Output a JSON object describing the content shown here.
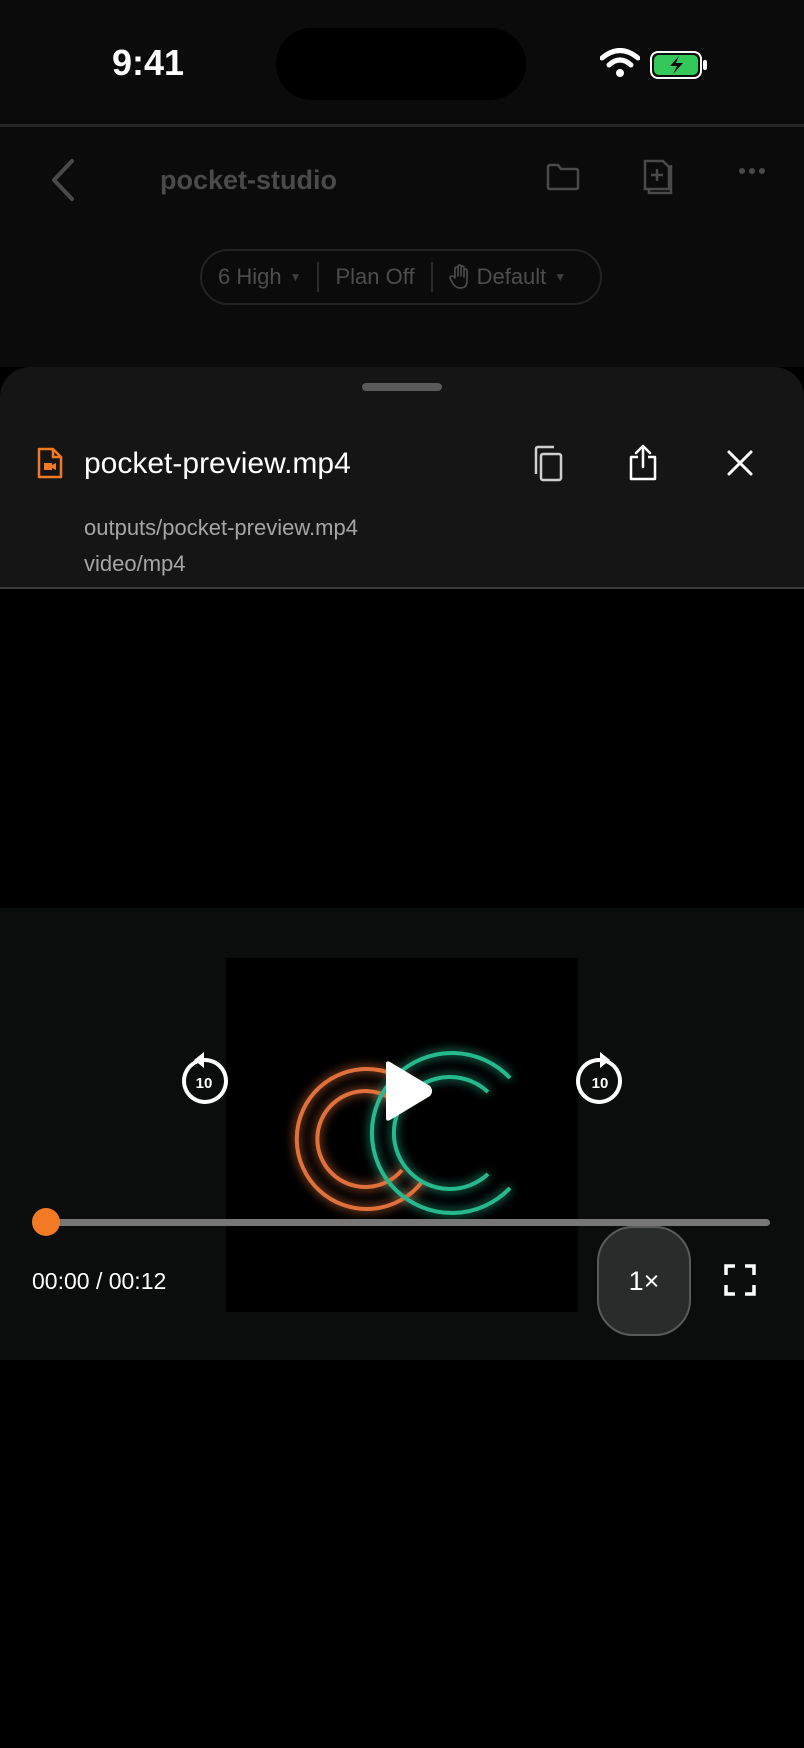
{
  "status_bar": {
    "time": "9:41"
  },
  "header": {
    "title": "pocket-studio",
    "controls": {
      "model": "6 High",
      "plan": "Plan Off",
      "approval": "Default"
    }
  },
  "sheet": {
    "file_name": "pocket-preview.mp4",
    "file_path": "outputs/pocket-preview.mp4",
    "mime_type": "video/mp4"
  },
  "player": {
    "skip_back_seconds": "10",
    "skip_forward_seconds": "10",
    "time_display": "00:00 / 00:12",
    "progress_fraction": 0,
    "speed_label": "1×"
  },
  "colors": {
    "accent": "#f37a24",
    "logo_orange": "#e0713a",
    "logo_teal": "#27b98e"
  }
}
